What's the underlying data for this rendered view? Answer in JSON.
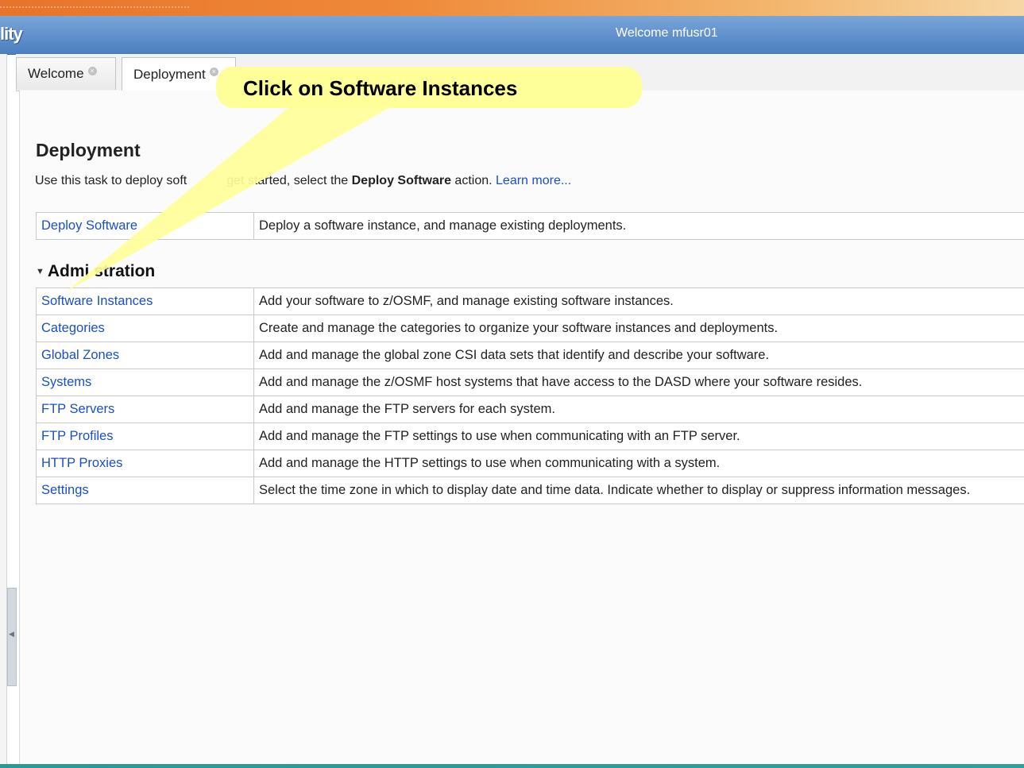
{
  "banner": {
    "app_title": "lity",
    "welcome_text": "Welcome mfusr01"
  },
  "tabs": [
    {
      "label": "Welcome",
      "close_icon": "close-icon"
    },
    {
      "label": "Deployment",
      "close_icon": "close-icon"
    }
  ],
  "callout": {
    "text": "Click on Software Instances",
    "color": "#ffff99"
  },
  "page": {
    "title": "Deployment",
    "intro_prefix": "Use this task to deploy soft",
    "intro_mid": "get started, select the ",
    "intro_bold": "Deploy Software",
    "intro_suffix": " action. ",
    "learn_more": "Learn more..."
  },
  "deploy_table": {
    "rows": [
      {
        "link": "Deploy Software",
        "desc": "Deploy a software instance, and manage existing deployments."
      }
    ]
  },
  "administration": {
    "heading_visible": "Admi   stration",
    "toggle_icon": "collapse-triangle-icon",
    "rows": [
      {
        "link": "Software Instances",
        "desc": "Add your software to z/OSMF, and manage existing software instances."
      },
      {
        "link": "Categories",
        "desc": "Create and manage the categories to organize your software instances and deployments."
      },
      {
        "link": "Global Zones",
        "desc": "Add and manage the global zone CSI data sets that identify and describe your software."
      },
      {
        "link": "Systems",
        "desc": "Add and manage the z/OSMF host systems that have access to the DASD where your software resides."
      },
      {
        "link": "FTP Servers",
        "desc": "Add and manage the FTP servers for each system."
      },
      {
        "link": "FTP Profiles",
        "desc": "Add and manage the FTP settings to use when communicating with an FTP server."
      },
      {
        "link": "HTTP Proxies",
        "desc": "Add and manage the HTTP settings to use when communicating with a system."
      },
      {
        "link": "Settings",
        "desc": "Select the time zone in which to display date and time data. Indicate whether to display or suppress information messages."
      }
    ]
  },
  "colors": {
    "banner_blue": "#5f8fcc",
    "link_blue": "#1a4fc7",
    "orange_strip": "#e8732a",
    "bottom_teal": "#2a9a97"
  }
}
